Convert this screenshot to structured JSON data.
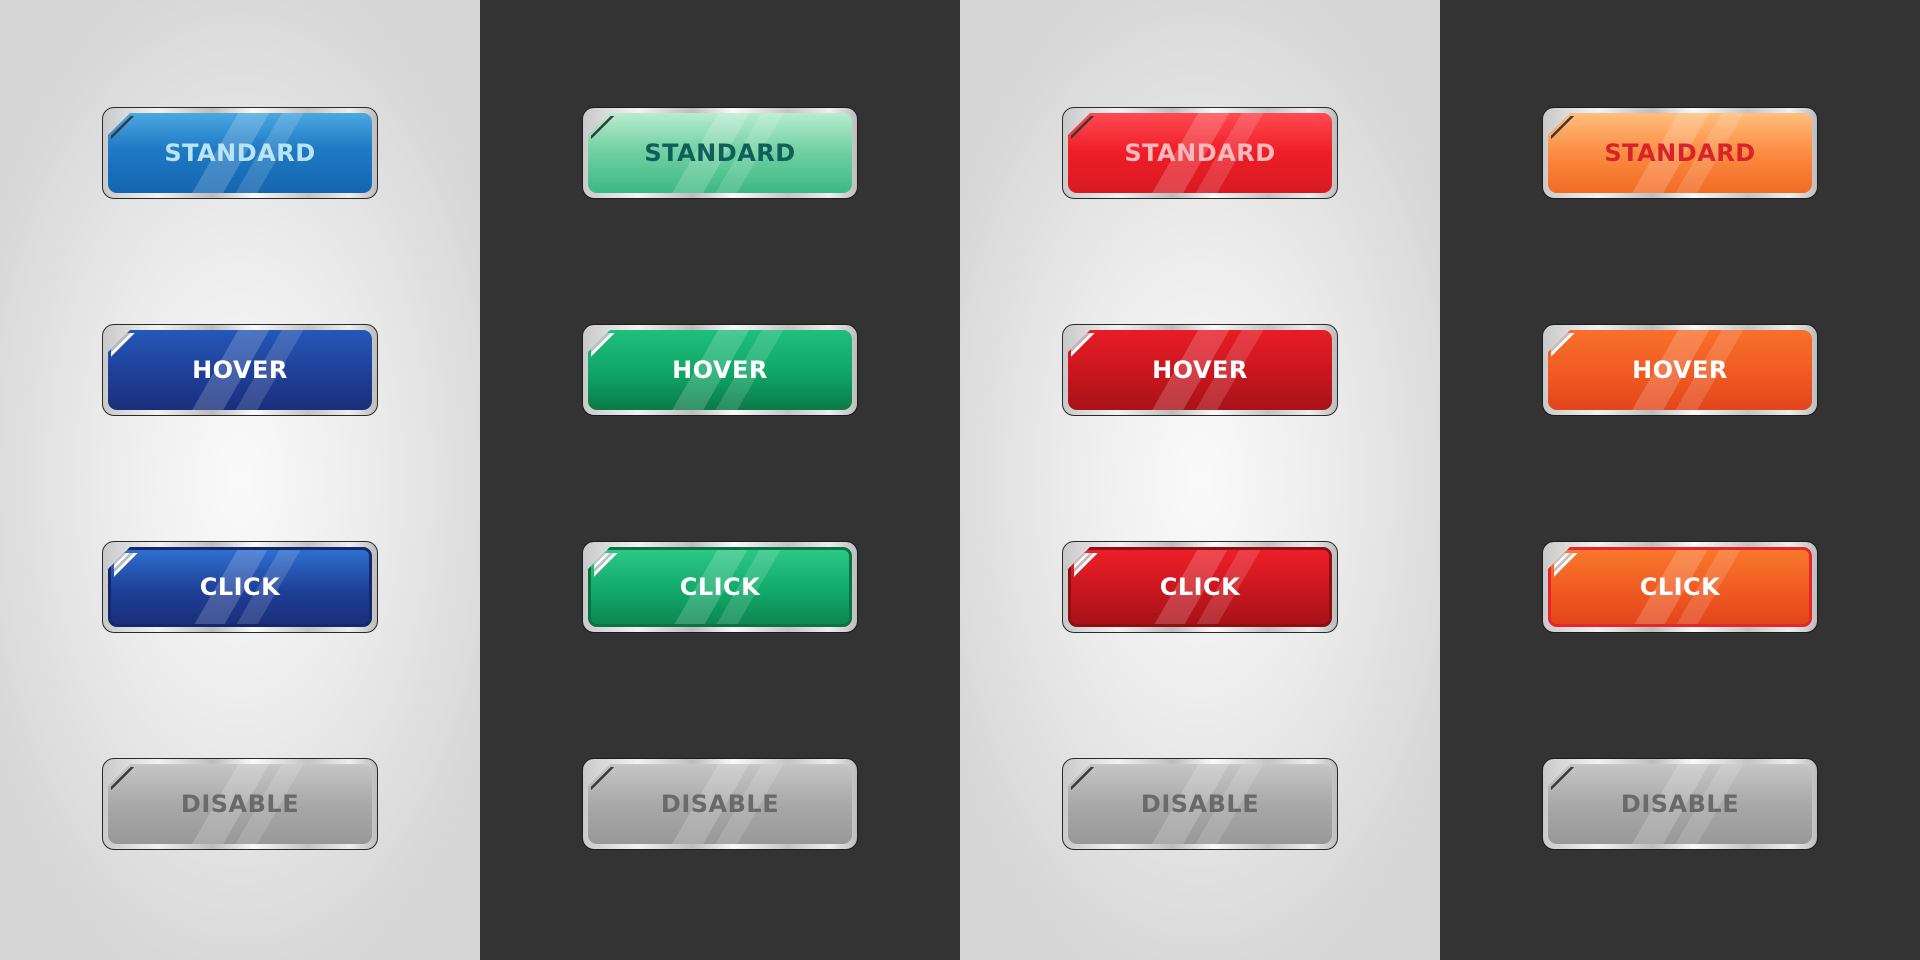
{
  "panels": [
    {
      "theme": "light",
      "color_name": "blue",
      "accent": "#1f7ac4",
      "buttons": [
        {
          "state": "standard",
          "label": "STANDARD"
        },
        {
          "state": "hover",
          "label": "HOVER"
        },
        {
          "state": "click",
          "label": "CLICK"
        },
        {
          "state": "disable",
          "label": "DISABLE"
        }
      ]
    },
    {
      "theme": "dark",
      "color_name": "green",
      "accent": "#0fa566",
      "buttons": [
        {
          "state": "standard",
          "label": "STANDARD"
        },
        {
          "state": "hover",
          "label": "HOVER"
        },
        {
          "state": "click",
          "label": "CLICK"
        },
        {
          "state": "disable",
          "label": "DISABLE"
        }
      ]
    },
    {
      "theme": "light",
      "color_name": "red",
      "accent": "#ee1d26",
      "buttons": [
        {
          "state": "standard",
          "label": "STANDARD"
        },
        {
          "state": "hover",
          "label": "HOVER"
        },
        {
          "state": "click",
          "label": "CLICK"
        },
        {
          "state": "disable",
          "label": "DISABLE"
        }
      ]
    },
    {
      "theme": "dark",
      "color_name": "orange",
      "accent": "#f05a22",
      "buttons": [
        {
          "state": "standard",
          "label": "STANDARD"
        },
        {
          "state": "hover",
          "label": "HOVER"
        },
        {
          "state": "click",
          "label": "CLICK"
        },
        {
          "state": "disable",
          "label": "DISABLE"
        }
      ]
    }
  ],
  "colors": {
    "light_panel_bg": "#e4e4e4",
    "dark_panel_bg": "#333333",
    "frame_silver": "#d0d0d0",
    "disabled_text": "#6a6a6a"
  }
}
